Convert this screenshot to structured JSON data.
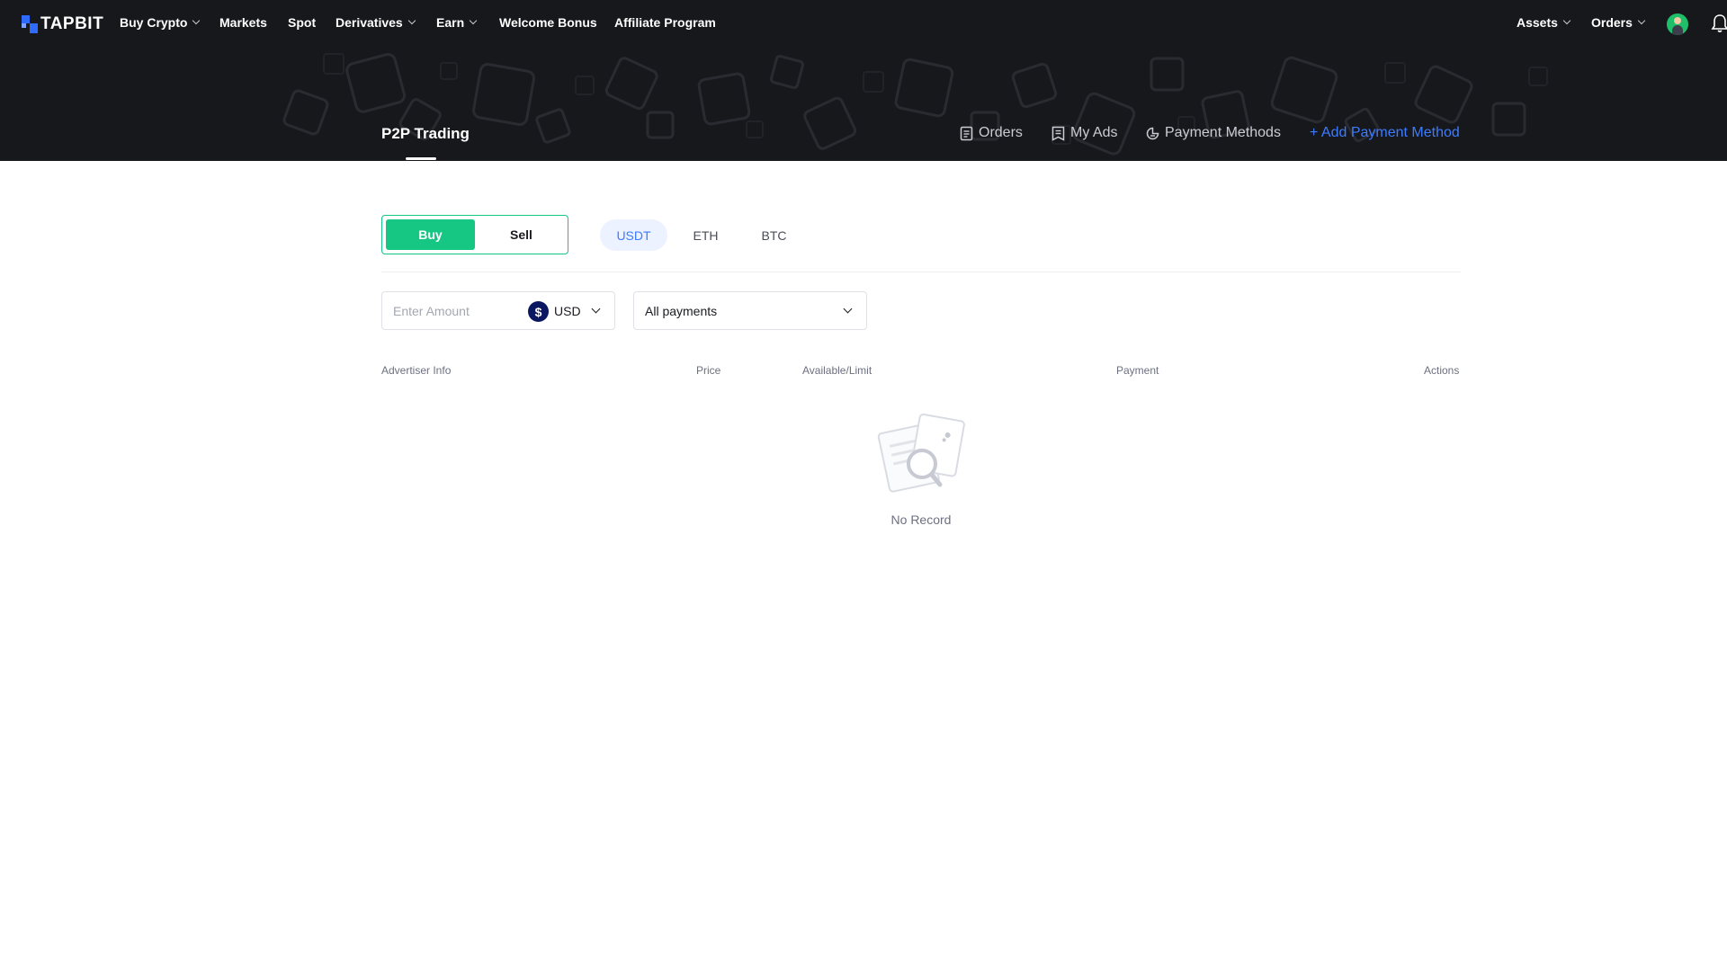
{
  "nav": {
    "logo_text": "TAPBIT",
    "items": [
      {
        "label": "Buy Crypto",
        "dropdown": true
      },
      {
        "label": "Markets",
        "dropdown": false
      },
      {
        "label": "Spot",
        "dropdown": false
      },
      {
        "label": "Derivatives",
        "dropdown": true
      },
      {
        "label": "Earn",
        "dropdown": true
      },
      {
        "label": "Welcome Bonus",
        "dropdown": false
      },
      {
        "label": "Affiliate Program",
        "dropdown": false
      }
    ],
    "right": [
      {
        "label": "Assets",
        "dropdown": true
      },
      {
        "label": "Orders",
        "dropdown": true
      }
    ]
  },
  "hero": {
    "title": "P2P Trading",
    "links": {
      "orders": "Orders",
      "my_ads": "My Ads",
      "payment_methods": "Payment Methods",
      "add_payment_method": "+ Add Payment Method"
    }
  },
  "trade": {
    "buy_label": "Buy",
    "sell_label": "Sell",
    "selected_side": "Buy",
    "coins": [
      "USDT",
      "ETH",
      "BTC"
    ],
    "selected_coin": "USDT"
  },
  "filters": {
    "amount_placeholder": "Enter Amount",
    "currency_symbol": "$",
    "currency": "USD",
    "payment_selected": "All payments"
  },
  "table": {
    "headers": {
      "advertiser": "Advertiser Info",
      "price": "Price",
      "available": "Available/Limit",
      "payment": "Payment",
      "actions": "Actions"
    },
    "rows": [],
    "empty_text": "No Record"
  },
  "colors": {
    "brand_blue": "#2f6bff",
    "buy_green": "#16c784",
    "link_blue": "#3d7bff",
    "header_bg": "#17181c"
  }
}
